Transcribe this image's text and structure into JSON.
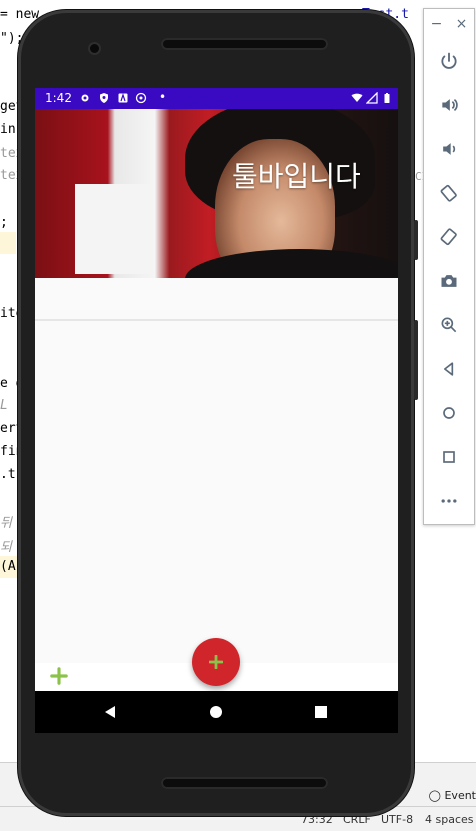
{
  "ide": {
    "code_fragments": [
      "= new",
      "\");",
      "getl",
      "in",
      "tex",
      "tex",
      ";",
      "ite",
      "e d",
      "L",
      "ert",
      "fin",
      ".t",
      "뒤",
      "되",
      "(A",
      "Test.t",
      "CI"
    ],
    "status": {
      "position": "73:32",
      "line_sep": "CRLF",
      "encoding": "UTF-8",
      "indent": "4 spaces"
    },
    "event_log": "Event"
  },
  "emulator_toolbar": {
    "items": [
      {
        "icon": "power-icon"
      },
      {
        "icon": "volume-up-icon"
      },
      {
        "icon": "volume-down-icon"
      },
      {
        "icon": "rotate-left-icon"
      },
      {
        "icon": "rotate-right-icon"
      },
      {
        "icon": "camera-icon"
      },
      {
        "icon": "zoom-icon"
      },
      {
        "icon": "back-icon"
      },
      {
        "icon": "home-icon"
      },
      {
        "icon": "overview-icon"
      },
      {
        "icon": "more-icon"
      }
    ]
  },
  "app": {
    "status_bar": {
      "time": "1:42",
      "dot": "•"
    },
    "toolbar": {
      "title": "툴바입니다"
    },
    "colors": {
      "status_bar": "#3a0ac3",
      "fab": "#d0262b",
      "add_icon": "#8bc34a"
    }
  }
}
